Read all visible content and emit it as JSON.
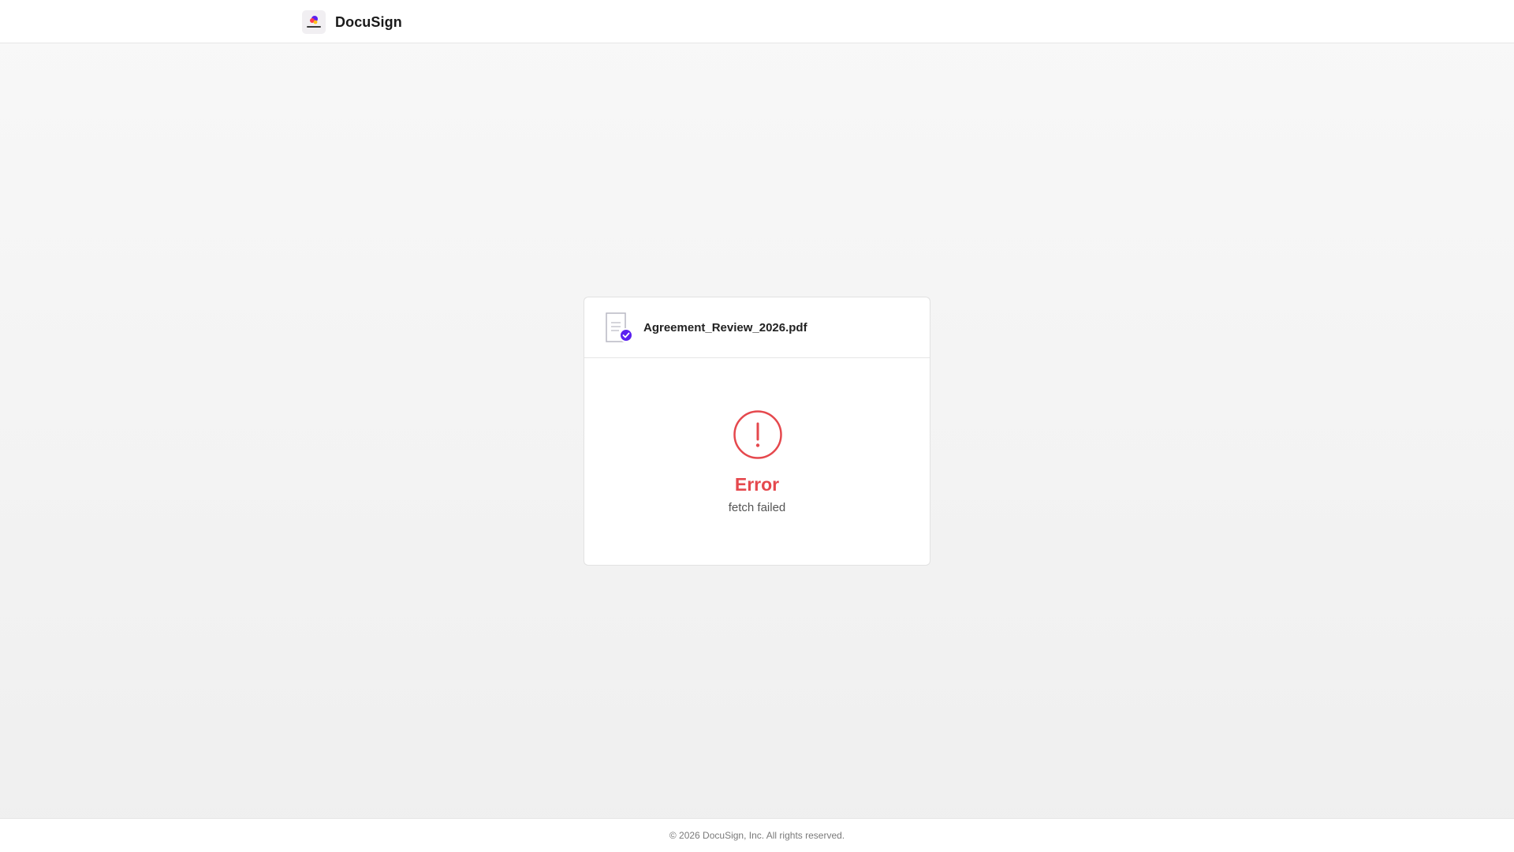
{
  "header": {
    "brand_name": "DocuSign",
    "logo_icon": "docusign-logo"
  },
  "document": {
    "file_name": "Agreement_Review_2026.pdf",
    "icon": "document-check-icon",
    "accent_color": "#5b21f0"
  },
  "error": {
    "icon": "alert-circle-icon",
    "title": "Error",
    "message": "fetch failed",
    "color": "#e5484d"
  },
  "footer": {
    "copyright": "© 2026 DocuSign, Inc. All rights reserved."
  }
}
